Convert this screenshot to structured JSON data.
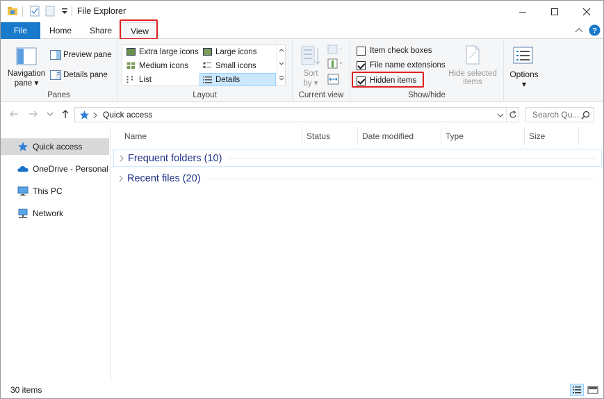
{
  "window": {
    "title": "File Explorer"
  },
  "tabs": {
    "file": "File",
    "home": "Home",
    "share": "Share",
    "view": "View"
  },
  "ribbon": {
    "panes": {
      "label": "Panes",
      "navigation_pane_line1": "Navigation",
      "navigation_pane_line2": "pane",
      "preview_pane": "Preview pane",
      "details_pane": "Details pane"
    },
    "layout": {
      "label": "Layout",
      "items": [
        {
          "label": "Extra large icons",
          "selected": false
        },
        {
          "label": "Large icons",
          "selected": false
        },
        {
          "label": "Medium icons",
          "selected": false
        },
        {
          "label": "Small icons",
          "selected": false
        },
        {
          "label": "List",
          "selected": false
        },
        {
          "label": "Details",
          "selected": true
        }
      ]
    },
    "current_view": {
      "label": "Current view",
      "sort_line1": "Sort",
      "sort_line2": "by"
    },
    "show_hide": {
      "label": "Show/hide",
      "item_check_boxes": {
        "label": "Item check boxes",
        "checked": false
      },
      "file_name_extensions": {
        "label": "File name extensions",
        "checked": true
      },
      "hidden_items": {
        "label": "Hidden items",
        "checked": true
      },
      "hide_selected_line1": "Hide selected",
      "hide_selected_line2": "items"
    },
    "options": {
      "label": "Options"
    }
  },
  "address": {
    "path": "Quick access",
    "search_placeholder": "Search Qu..."
  },
  "nav_pane": {
    "items": [
      {
        "label": "Quick access",
        "icon": "star-icon",
        "selected": true
      },
      {
        "label": "OneDrive - Personal",
        "icon": "cloud-icon",
        "selected": false
      },
      {
        "label": "This PC",
        "icon": "monitor-icon",
        "selected": false
      },
      {
        "label": "Network",
        "icon": "network-icon",
        "selected": false
      }
    ]
  },
  "columns": [
    "Name",
    "Status",
    "Date modified",
    "Type",
    "Size"
  ],
  "groups": [
    {
      "title": "Frequent folders (10)"
    },
    {
      "title": "Recent files (20)"
    }
  ],
  "status": {
    "item_count": "30 items"
  },
  "colors": {
    "file_tab": "#1979ca",
    "highlight_box": "#e02020",
    "group_title": "#1e3287",
    "selection": "#cce8ff"
  }
}
